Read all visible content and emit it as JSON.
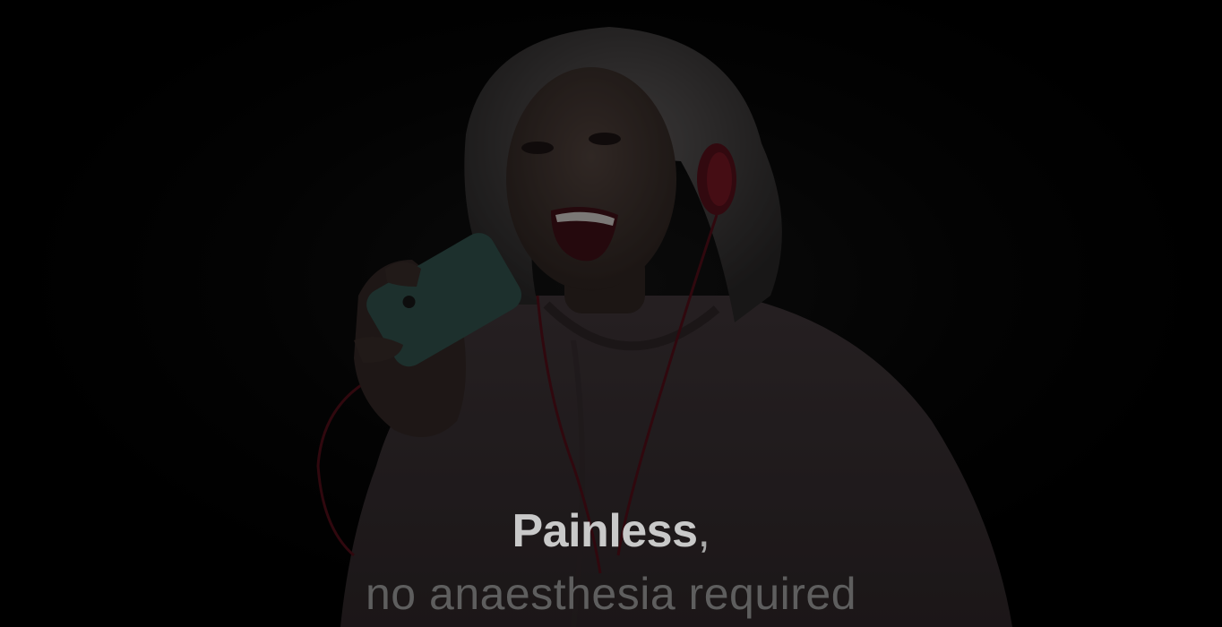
{
  "hero": {
    "headline_strong": "Painless",
    "headline_punct": ",",
    "headline_sub": "no anaesthesia required"
  },
  "colors": {
    "background": "#000000",
    "headline_primary": "#c9c9c9",
    "headline_secondary": "#5e5e5e",
    "hoodie": "#3a2f32",
    "phone": "#2d4a45",
    "headphones": "#6a1420"
  },
  "image": {
    "subject": "hero-photo-woman-headphones-phone"
  }
}
